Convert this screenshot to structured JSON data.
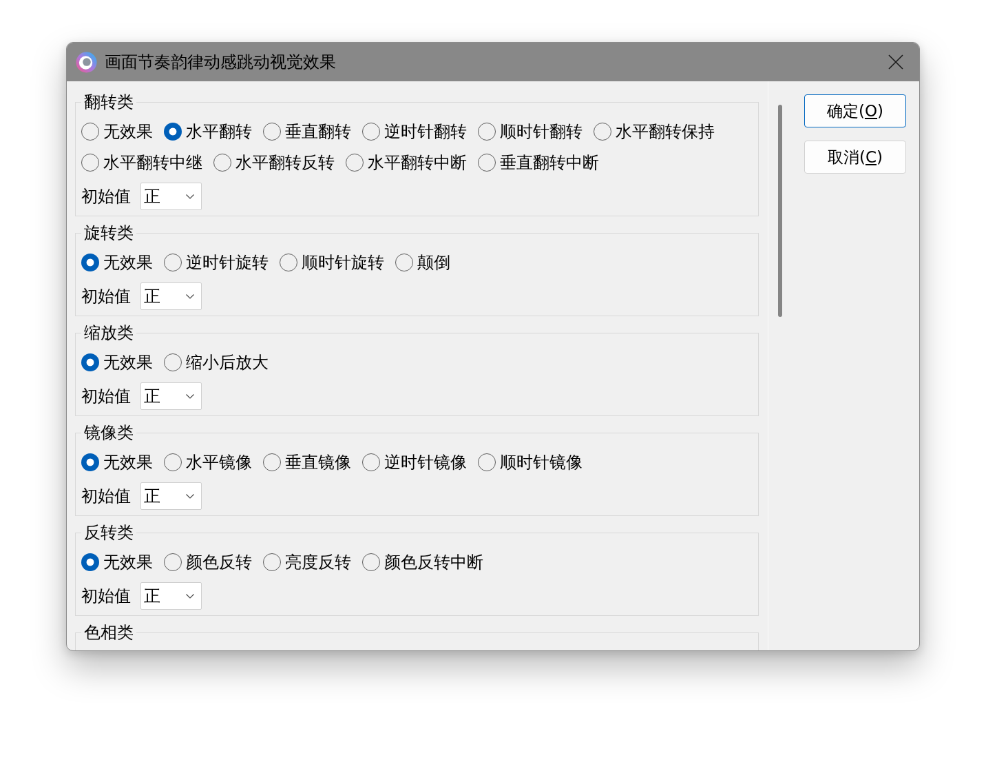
{
  "window": {
    "title": "画面节奏韵律动感跳动视觉效果"
  },
  "groups": [
    {
      "title": "翻转类",
      "options": [
        {
          "label": "无效果",
          "selected": false
        },
        {
          "label": "水平翻转",
          "selected": true
        },
        {
          "label": "垂直翻转",
          "selected": false
        },
        {
          "label": "逆时针翻转",
          "selected": false
        },
        {
          "label": "顺时针翻转",
          "selected": false
        },
        {
          "label": "水平翻转保持",
          "selected": false
        },
        {
          "label": "水平翻转中继",
          "selected": false
        },
        {
          "label": "水平翻转反转",
          "selected": false
        },
        {
          "label": "水平翻转中断",
          "selected": false
        },
        {
          "label": "垂直翻转中断",
          "selected": false
        }
      ],
      "initial": {
        "label": "初始值",
        "value": "正"
      }
    },
    {
      "title": "旋转类",
      "options": [
        {
          "label": "无效果",
          "selected": true
        },
        {
          "label": "逆时针旋转",
          "selected": false
        },
        {
          "label": "顺时针旋转",
          "selected": false
        },
        {
          "label": "颠倒",
          "selected": false
        }
      ],
      "initial": {
        "label": "初始值",
        "value": "正"
      }
    },
    {
      "title": "缩放类",
      "options": [
        {
          "label": "无效果",
          "selected": true
        },
        {
          "label": "缩小后放大",
          "selected": false
        }
      ],
      "initial": {
        "label": "初始值",
        "value": "正"
      }
    },
    {
      "title": "镜像类",
      "options": [
        {
          "label": "无效果",
          "selected": true
        },
        {
          "label": "水平镜像",
          "selected": false
        },
        {
          "label": "垂直镜像",
          "selected": false
        },
        {
          "label": "逆时针镜像",
          "selected": false
        },
        {
          "label": "顺时针镜像",
          "selected": false
        }
      ],
      "initial": {
        "label": "初始值",
        "value": "正"
      }
    },
    {
      "title": "反转类",
      "options": [
        {
          "label": "无效果",
          "selected": true
        },
        {
          "label": "颜色反转",
          "selected": false
        },
        {
          "label": "亮度反转",
          "selected": false
        },
        {
          "label": "颜色反转中断",
          "selected": false
        }
      ],
      "initial": {
        "label": "初始值",
        "value": "正"
      }
    },
    {
      "title": "色相类"
    }
  ],
  "buttons": [
    {
      "label": "确定(",
      "access_key": "O",
      "label_end": ")",
      "default": true
    },
    {
      "label": "取消(",
      "access_key": "C",
      "label_end": ")",
      "default": false
    }
  ]
}
